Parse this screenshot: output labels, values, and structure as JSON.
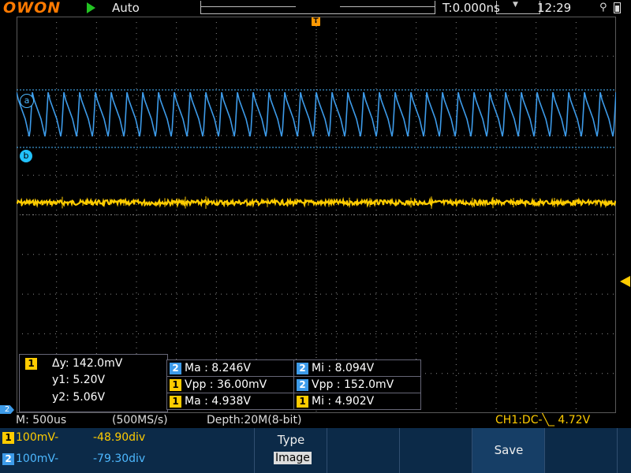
{
  "header": {
    "brand": "OWON",
    "run_state_icon": "run-play-icon",
    "mode": "Auto",
    "trigger_time": "T:0.000ns",
    "clock": "12:29",
    "usb_icon": "usb-icon",
    "battery_icon": "battery-icon",
    "trigger_marker": "T"
  },
  "colors": {
    "ch1": "#ffcc00",
    "ch2": "#3d9be9",
    "grid": "#8a8a8a",
    "cursor": "#4db8ff",
    "background": "#000000",
    "softkey_bg": "#0c2a48"
  },
  "cursors": {
    "a_label": "a",
    "b_label": "b",
    "channel": "1",
    "dy": "Δy: 142.0mV",
    "y1": "y1: 5.20V",
    "y2": "y2: 5.06V"
  },
  "measurements": [
    {
      "ch": "2",
      "text": "Ma : 8.246V"
    },
    {
      "ch": "2",
      "text": "Mi : 8.094V"
    },
    {
      "ch": "1",
      "text": "Vpp : 36.00mV"
    },
    {
      "ch": "2",
      "text": "Vpp : 152.0mV"
    },
    {
      "ch": "1",
      "text": "Ma : 4.938V"
    },
    {
      "ch": "1",
      "text": "Mi : 4.902V"
    }
  ],
  "status": {
    "timebase": "M: 500us",
    "sample_rate": "(500MS/s)",
    "depth": "Depth:20M(8-bit)",
    "trigger": "CH1:DC-╲_ 4.72V"
  },
  "channels": [
    {
      "num": "1",
      "scale": "100mV-",
      "offset": "-48.90div"
    },
    {
      "num": "2",
      "scale": "100mV-",
      "offset": "-79.30div"
    }
  ],
  "softkeys": {
    "type_title": "Type",
    "type_value": "Image",
    "save": "Save"
  },
  "markers": {
    "ch2_ground": "2"
  },
  "waveforms": {
    "ch2": {
      "shape": "sawtooth",
      "cycles": 38,
      "amplitude_mV": 152.0
    },
    "ch1": {
      "shape": "noisy-flat",
      "amplitude_mV": 36.0
    }
  }
}
